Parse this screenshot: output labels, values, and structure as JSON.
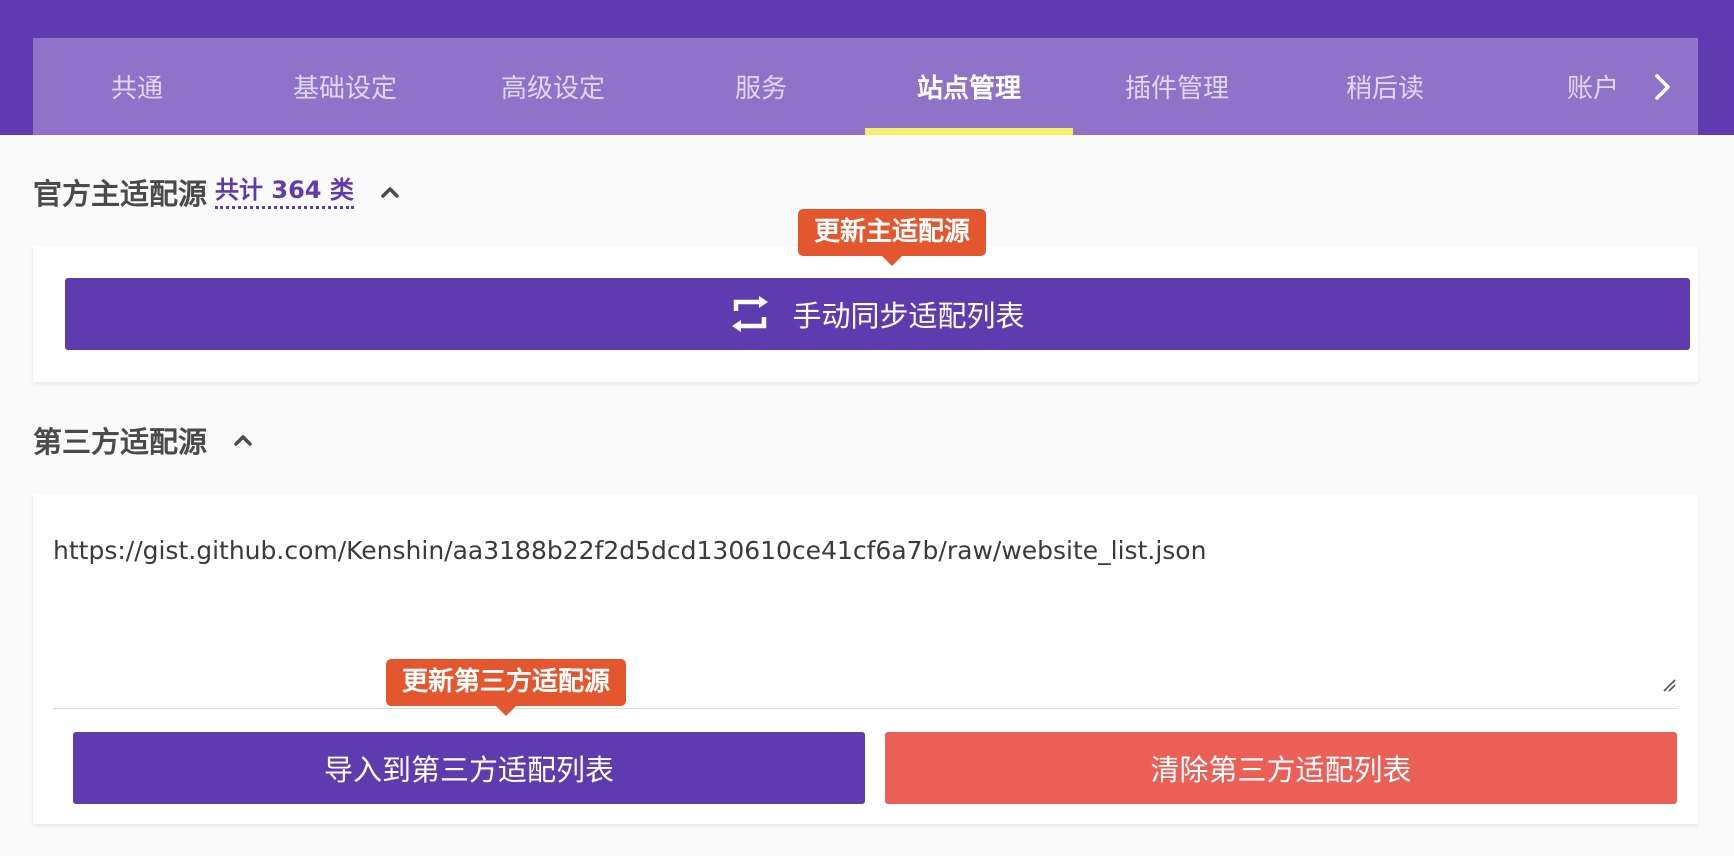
{
  "tabs": [
    {
      "label": "共通"
    },
    {
      "label": "基础设定"
    },
    {
      "label": "高级设定"
    },
    {
      "label": "服务"
    },
    {
      "label": "站点管理"
    },
    {
      "label": "插件管理"
    },
    {
      "label": "稍后读"
    },
    {
      "label": "账户"
    }
  ],
  "active_tab": "站点管理",
  "tab_next_icon": "chevron-right-icon",
  "official_section": {
    "title": "官方主适配源",
    "count_label": "共计 364 类",
    "collapse_icon": "chevron-up-icon",
    "tooltip": "更新主适配源",
    "sync_button_label": "手动同步适配列表",
    "sync_icon": "refresh-icon"
  },
  "third_party_section": {
    "title": "第三方适配源",
    "collapse_icon": "chevron-up-icon",
    "url_value": "https://gist.github.com/Kenshin/aa3188b22f2d5dcd130610ce41cf6a7b/raw/website_list.json",
    "tooltip": "更新第三方适配源",
    "import_button_label": "导入到第三方适配列表",
    "clear_button_label": "清除第三方适配列表"
  },
  "colors": {
    "primary": "#5e3bb0",
    "tab_bar": "#8e73c8",
    "active_indicator": "#f2f06a",
    "tooltip": "#e4572e",
    "danger": "#ec5f57"
  }
}
